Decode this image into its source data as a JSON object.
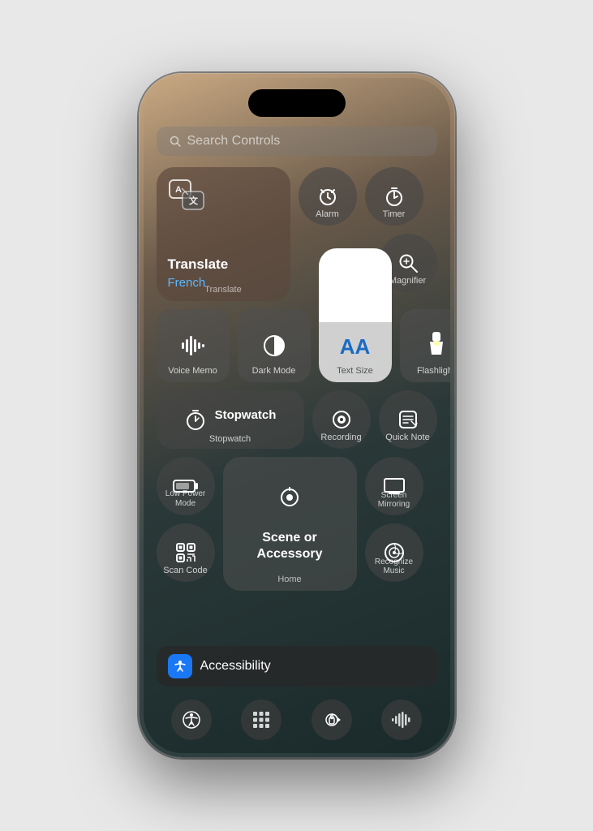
{
  "phone": {
    "search": {
      "placeholder": "Search Controls"
    },
    "controls": {
      "translate": {
        "icon_label": "translate-icon",
        "title": "Translate",
        "subtitle": "French",
        "label": "Translate"
      },
      "alarm": {
        "label": "Alarm"
      },
      "timer": {
        "label": "Timer"
      },
      "magnifier": {
        "label": "Magnifier"
      },
      "voice_memo": {
        "label": "Voice Memo"
      },
      "dark_mode": {
        "label": "Dark Mode"
      },
      "text_size": {
        "label": "Text Size",
        "aa_text": "AA"
      },
      "flashlight": {
        "label": "Flashlight"
      },
      "stopwatch": {
        "label": "Stopwatch",
        "title": "Stopwatch"
      },
      "recording": {
        "label": "Recording"
      },
      "quick_note": {
        "label": "Quick Note"
      },
      "low_power": {
        "label": "Low Power Mode"
      },
      "scan_code": {
        "label": "Scan Code"
      },
      "scene_accessory": {
        "title": "Scene or\nAccessory",
        "label": "Home"
      },
      "screen_mirror": {
        "label": "Screen Mirroring"
      },
      "recognize_music": {
        "label": "Recognize Music"
      }
    },
    "accessibility": {
      "label": "Accessibility"
    },
    "bottom_nav": {
      "items": [
        "accessibility",
        "keypad",
        "lock-rotation",
        "audio-waveform"
      ]
    }
  }
}
